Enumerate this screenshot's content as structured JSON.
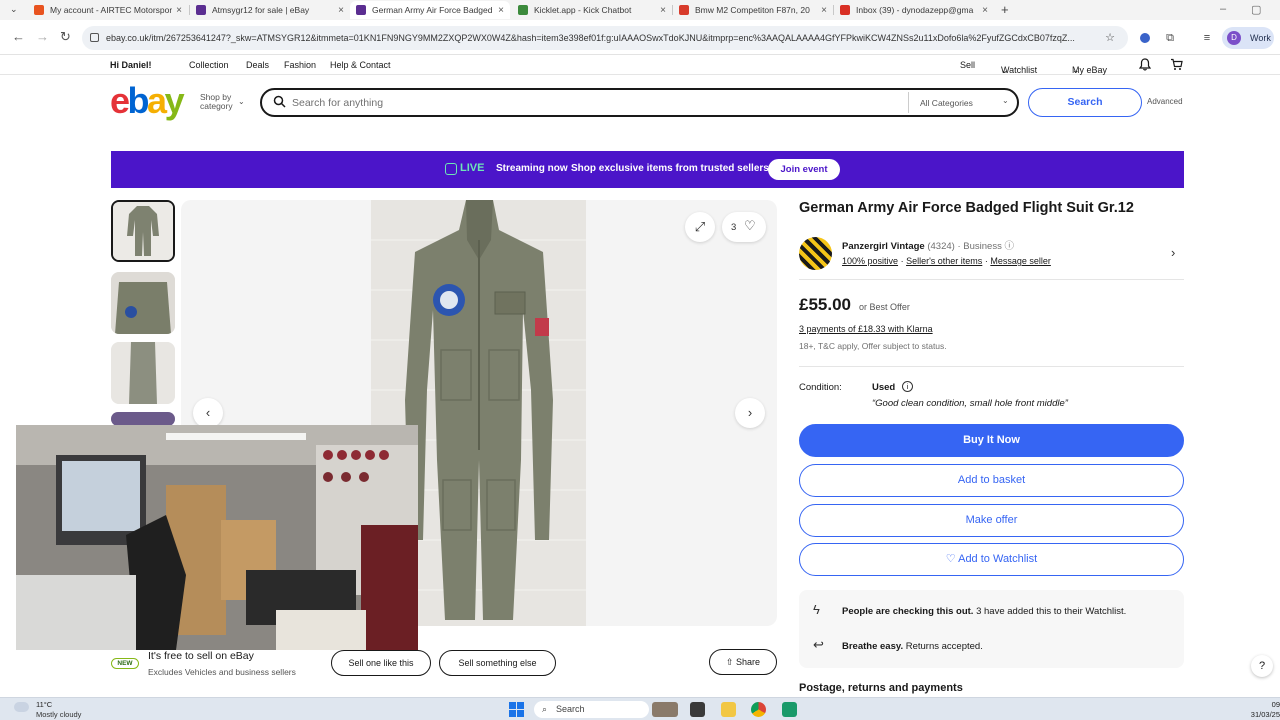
{
  "browser": {
    "tabs": [
      {
        "label": "My account - AIRTEC Motorsport",
        "color": "#e8531f"
      },
      {
        "label": "Atmsygr12 for sale | eBay",
        "color": "#5b2e91"
      },
      {
        "label": "German Army Air Force Badged",
        "color": "#5b2e91"
      },
      {
        "label": "Kicklet.app - Kick Chatbot",
        "color": "#3c8a3c"
      },
      {
        "label": "Bmw M2 Competiton F87n, 20",
        "color": "#d83b2b"
      },
      {
        "label": "Inbox (39) - dynodazepp@gma",
        "color": "#d93025"
      }
    ],
    "url": "ebay.co.uk/itm/267253641247?_skw=ATMSYGR12&itmmeta=01KN1FN9NGY9MM2ZXQP2WX0W4Z&hash=item3e398ef01f:g:uIAAAOSwxTdoKJNU&itmprp=enc%3AAQALAAAA4GfYFPkwiKCW4ZNSs2u11xDofo6la%2FyufZGCdxCB07fzqZ...",
    "profile_initial": "D",
    "profile_label": "Work"
  },
  "topnav": {
    "greeting": "Hi Daniel!",
    "links": [
      "Collection",
      "Deals",
      "Fashion",
      "Help & Contact"
    ],
    "sell": "Sell",
    "watchlist": "Watchlist",
    "my_ebay": "My eBay"
  },
  "header": {
    "logo": {
      "e": "e",
      "b": "b",
      "a": "a",
      "y": "y"
    },
    "shop_by": "Shop by category",
    "search_placeholder": "Search for anything",
    "category": "All Categories",
    "search_button": "Search",
    "advanced": "Advanced"
  },
  "banner": {
    "live": "LIVE",
    "streaming": "Streaming now",
    "message": "Shop exclusive items from trusted sellers",
    "cta": "Join event"
  },
  "gallery": {
    "like_count": "3"
  },
  "item": {
    "title": "German Army Air Force Badged Flight Suit Gr.12",
    "seller_name": "Panzergirl Vintage",
    "seller_count": "(4324)",
    "seller_type": "Business",
    "positive": "100% positive",
    "other_items": "Seller's other items",
    "message": "Message seller",
    "price": "£55.00",
    "best_offer": "or Best Offer",
    "klarna": "3 payments of £18.33 with Klarna",
    "klarna_note": "18+, T&C apply, Offer subject to status.",
    "condition_label": "Condition:",
    "condition_value": "Used",
    "condition_note": "“Good clean condition, small hole front middle”",
    "buy_now": "Buy It Now",
    "add_basket": "Add to basket",
    "make_offer": "Make offer",
    "add_watchlist": "♡ Add to Watchlist",
    "checking_bold": "People are checking this out.",
    "checking_rest": " 3 have added this to their Watchlist.",
    "returns_bold": "Breathe easy.",
    "returns_rest": " Returns accepted.",
    "postage": "Postage, returns and payments"
  },
  "sellbar": {
    "badge": "NEW",
    "free": "It's free to sell on eBay",
    "excludes": "Excludes Vehicles and business sellers",
    "sell_one": "Sell one like this",
    "sell_something": "Sell something else",
    "share": "Share"
  },
  "taskbar": {
    "temp": "11°C",
    "weather": "Mostly cloudy",
    "search": "Search",
    "time": "09",
    "date": "31/03/25"
  },
  "colors": {
    "ebay_blue": "#3665f3",
    "banner_purple": "#4b15c9",
    "live_green": "#6ee7b7"
  }
}
